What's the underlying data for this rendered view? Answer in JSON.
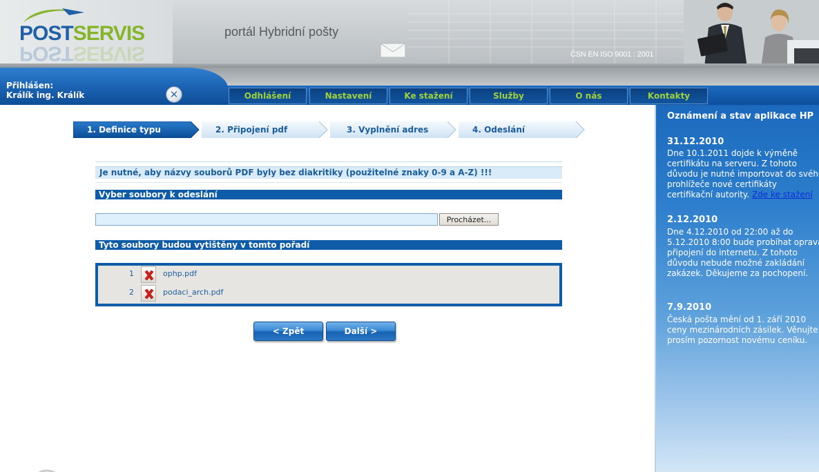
{
  "header": {
    "logo_post": "POST",
    "logo_servis": "SERVIS",
    "portal_title": "portál  Hybridní pošty",
    "iso_text": "ČSN EN ISO 9001 : 2001"
  },
  "user": {
    "login_label": "Přihlášen:",
    "user_name": "Králík ing. Králík"
  },
  "nav": {
    "items": [
      {
        "label": "Odhlášení"
      },
      {
        "label": "Nastavení"
      },
      {
        "label": "Ke stažení"
      },
      {
        "label": "Služby"
      },
      {
        "label": "O nás"
      },
      {
        "label": "Kontakty"
      }
    ]
  },
  "steps": [
    {
      "label": "1. Definice typu",
      "active": true
    },
    {
      "label": "2. Připojení pdf",
      "active": false
    },
    {
      "label": "3. Vyplnění adres",
      "active": false
    },
    {
      "label": "4. Odeslání",
      "active": false
    }
  ],
  "main": {
    "notice": "Je nutné, aby názvy souborů PDF byly bez diakritiky (použitelné znaky 0-9 a A-Z) !!!",
    "select_section": "Vyber soubory k odeslání",
    "file_input_value": "",
    "browse_label": "Procházet...",
    "order_section": "Tyto soubory budou vytištěny v tomto pořadí",
    "files": [
      {
        "num": "1",
        "name": "ophp.pdf"
      },
      {
        "num": "2",
        "name": "podaci_arch.pdf"
      }
    ],
    "back_label": "< Zpět",
    "next_label": "Další >"
  },
  "sidebar": {
    "title": "Oznámení a stav aplikace HP",
    "news": [
      {
        "date": "31.12.2010",
        "text": "Dne 10.1.2011 dojde k výměně certifikátu na serveru. Z tohoto důvodu je nutné importovat do svého prohlížeče nové certifikáty certifikační autority.",
        "link": "Zde ke stažení"
      },
      {
        "date": "2.12.2010",
        "text": "Dne 4.12.2010 od 22:00 až do 5.12.2010 8:00 bude probíhat oprava připojení do internetu. Z tohoto důvodu nebude možné zakládání zakázek. Děkujeme za pochopení.",
        "link": ""
      },
      {
        "date": "7.9.2010",
        "text": "Česká pošta mění od 1. září 2010 ceny mezinárodních zásilek. Věnujte prosím pozornost novému ceníku.",
        "link": ""
      }
    ]
  },
  "colors": {
    "brand_blue": "#0e5ca8",
    "brand_green": "#86b52b",
    "nav_text": "#9fd33a",
    "link_blue": "#1b5d9c"
  }
}
